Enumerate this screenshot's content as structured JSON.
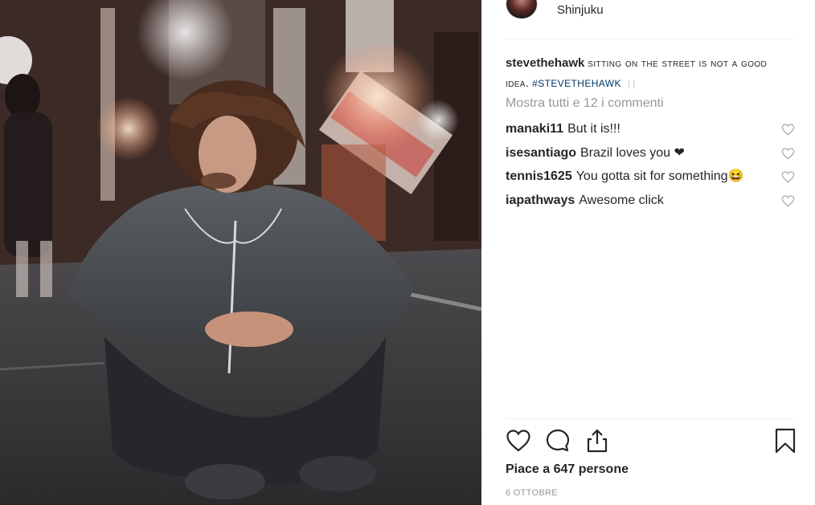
{
  "post": {
    "location": "Shinjuku",
    "caption_user": "stevethehawk",
    "caption_text": "SITTING ON THE STREET IS NOT A GOOD IDEA.",
    "caption_hashtag": "#STEVETHEHAWK",
    "caption_trailing": "| |",
    "view_all_comments": "Mostra tutti e 12 i commenti",
    "likes": "Piace a 647 persone",
    "date": "6 OTTOBRE"
  },
  "comments": [
    {
      "user": "manaki11",
      "text": "But it is!!!"
    },
    {
      "user": "isesantiago",
      "text": "Brazil loves you ❤"
    },
    {
      "user": "tennis1625",
      "text": "You gotta sit for something😆"
    },
    {
      "user": "iapathways",
      "text": "Awesome click"
    }
  ],
  "icons": {
    "like": "heart-icon",
    "comment": "comment-bubble-icon",
    "share": "share-icon",
    "save": "bookmark-icon",
    "comment_like": "heart-icon"
  },
  "colors": {
    "text": "#262626",
    "muted": "#999999",
    "hashtag": "#003569"
  }
}
